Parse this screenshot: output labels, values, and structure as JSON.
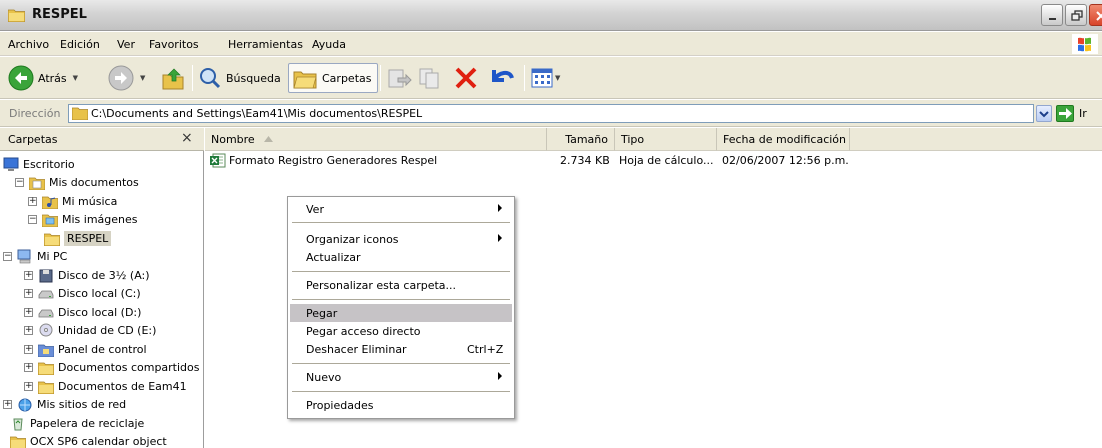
{
  "window": {
    "title": "RESPEL"
  },
  "menubar": {
    "items": [
      "Archivo",
      "Edición",
      "Ver",
      "Favoritos",
      "Herramientas",
      "Ayuda"
    ]
  },
  "toolbar": {
    "back": "Atrás",
    "search": "Búsqueda",
    "folders": "Carpetas"
  },
  "address": {
    "label": "Dirección",
    "value": "C:\\Documents and Settings\\Eam41\\Mis documentos\\RESPEL",
    "go": "Ir"
  },
  "folders_pane": {
    "title": "Carpetas",
    "close": "×",
    "tree": [
      {
        "label": "Escritorio",
        "icon": "desktop-icon",
        "expander": ""
      },
      {
        "label": "Mis documentos",
        "icon": "documents-folder-icon",
        "expander": "−"
      },
      {
        "label": "Mi música",
        "icon": "music-folder-icon",
        "expander": "+"
      },
      {
        "label": "Mis imágenes",
        "icon": "pictures-folder-icon",
        "expander": "−"
      },
      {
        "label": "RESPEL",
        "icon": "folder-icon",
        "expander": ""
      },
      {
        "label": "Mi PC",
        "icon": "computer-icon",
        "expander": "−"
      },
      {
        "label": "Disco de 3½ (A:)",
        "icon": "floppy-drive-icon",
        "expander": "+"
      },
      {
        "label": "Disco local (C:)",
        "icon": "hard-drive-icon",
        "expander": "+"
      },
      {
        "label": "Disco local (D:)",
        "icon": "hard-drive-icon",
        "expander": "+"
      },
      {
        "label": "Unidad de CD (E:)",
        "icon": "cd-drive-icon",
        "expander": "+"
      },
      {
        "label": "Panel de control",
        "icon": "control-panel-icon",
        "expander": "+"
      },
      {
        "label": "Documentos compartidos",
        "icon": "folder-icon",
        "expander": "+"
      },
      {
        "label": "Documentos de Eam41",
        "icon": "folder-icon",
        "expander": "+"
      },
      {
        "label": "Mis sitios de red",
        "icon": "network-icon",
        "expander": "+"
      },
      {
        "label": "Papelera de reciclaje",
        "icon": "recycle-bin-icon",
        "expander": ""
      },
      {
        "label": "OCX SP6 calendar object",
        "icon": "folder-icon",
        "expander": ""
      }
    ]
  },
  "filelist": {
    "columns": {
      "name": "Nombre",
      "size": "Tamaño",
      "type": "Tipo",
      "modified": "Fecha de modificación"
    },
    "rows": [
      {
        "name": "Formato Registro Generadores Respel",
        "size": "2.734 KB",
        "type": "Hoja de cálculo...",
        "modified": "02/06/2007 12:56 p.m.",
        "icon": "excel-file-icon"
      }
    ]
  },
  "context_menu": {
    "items": [
      {
        "label": "Ver",
        "submenu": true
      },
      {
        "label": "Organizar iconos",
        "submenu": true
      },
      {
        "label": "Actualizar"
      },
      {
        "label": "Personalizar esta carpeta..."
      },
      {
        "label": "Pegar",
        "highlighted": true
      },
      {
        "label": "Pegar acceso directo"
      },
      {
        "label": "Deshacer Eliminar",
        "shortcut": "Ctrl+Z"
      },
      {
        "label": "Nuevo",
        "submenu": true
      },
      {
        "label": "Propiedades"
      }
    ]
  }
}
